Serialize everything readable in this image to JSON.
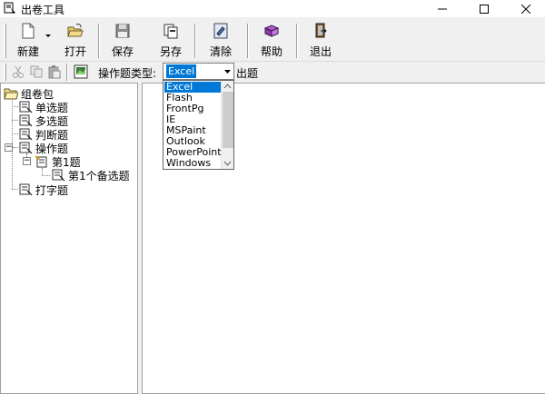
{
  "window": {
    "title": "出卷工具",
    "icon": "app-icon"
  },
  "toolbar": {
    "new_label": "新建",
    "open_label": "打开",
    "save_label": "保存",
    "saveas_label": "另存",
    "clear_label": "清除",
    "help_label": "帮助",
    "exit_label": "退出"
  },
  "toolbar2": {
    "type_label": "操作题类型:",
    "type_value": "Excel",
    "generate_label": "出题"
  },
  "tree": {
    "root": "组卷包",
    "items": [
      {
        "label": "单选题"
      },
      {
        "label": "多选题"
      },
      {
        "label": "判断题"
      },
      {
        "label": "操作题"
      },
      {
        "label": "第1题"
      },
      {
        "label": "第1个备选题"
      },
      {
        "label": "打字题"
      }
    ]
  },
  "dropdown": {
    "options": [
      "Excel",
      "Flash",
      "FrontPg",
      "IE",
      "MSPaint",
      "Outlook",
      "PowerPoint",
      "Windows"
    ],
    "selected": "Excel"
  }
}
